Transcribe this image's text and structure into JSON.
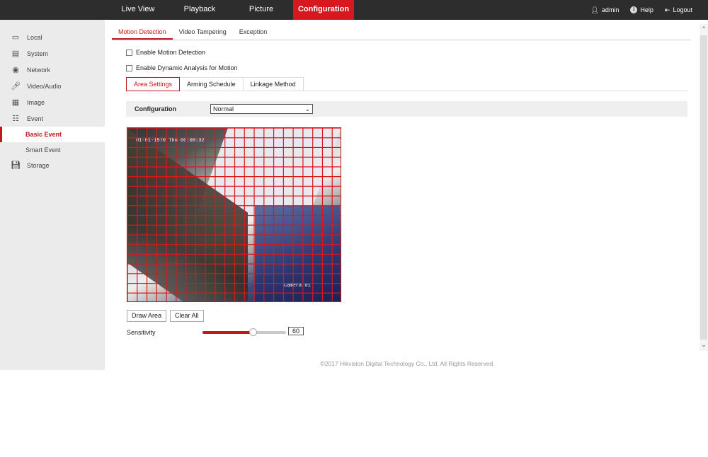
{
  "topnav": {
    "items": [
      {
        "label": "Live View"
      },
      {
        "label": "Playback"
      },
      {
        "label": "Picture"
      },
      {
        "label": "Configuration",
        "active": true
      }
    ],
    "user": "admin",
    "help": "Help",
    "logout": "Logout"
  },
  "sidebar": {
    "items": [
      {
        "label": "Local",
        "icon": "monitor-icon"
      },
      {
        "label": "System",
        "icon": "window-icon"
      },
      {
        "label": "Network",
        "icon": "globe-icon"
      },
      {
        "label": "Video/Audio",
        "icon": "microphone-icon"
      },
      {
        "label": "Image",
        "icon": "image-icon"
      },
      {
        "label": "Event",
        "icon": "calendar-icon"
      },
      {
        "label": "Basic Event",
        "active": true
      },
      {
        "label": "Smart Event"
      },
      {
        "label": "Storage",
        "icon": "disk-icon"
      }
    ]
  },
  "tabs": [
    "Motion Detection",
    "Video Tampering",
    "Exception"
  ],
  "checkboxes": {
    "enable_motion": {
      "label": "Enable Motion Detection",
      "checked": false
    },
    "enable_dynamic": {
      "label": "Enable Dynamic Analysis for Motion",
      "checked": false
    }
  },
  "subtabs": [
    "Area Settings",
    "Arming Schedule",
    "Linkage Method"
  ],
  "configuration": {
    "label": "Configuration",
    "value": "Normal"
  },
  "video": {
    "camera_name": "Camera 01",
    "grid_columns": 22,
    "grid_rows": 18,
    "grid_color": "#d7191f"
  },
  "buttons": {
    "draw_area": "Draw Area",
    "clear_all": "Clear All"
  },
  "sensitivity": {
    "label": "Sensitivity",
    "value": "60",
    "percent": 60
  },
  "footer": "©2017 Hikvision Digital Technology Co., Ltd. All Rights Reserved.",
  "colors": {
    "accent": "#d7191f",
    "topbar": "#2d2d2d",
    "sidebar": "#ebebeb"
  }
}
